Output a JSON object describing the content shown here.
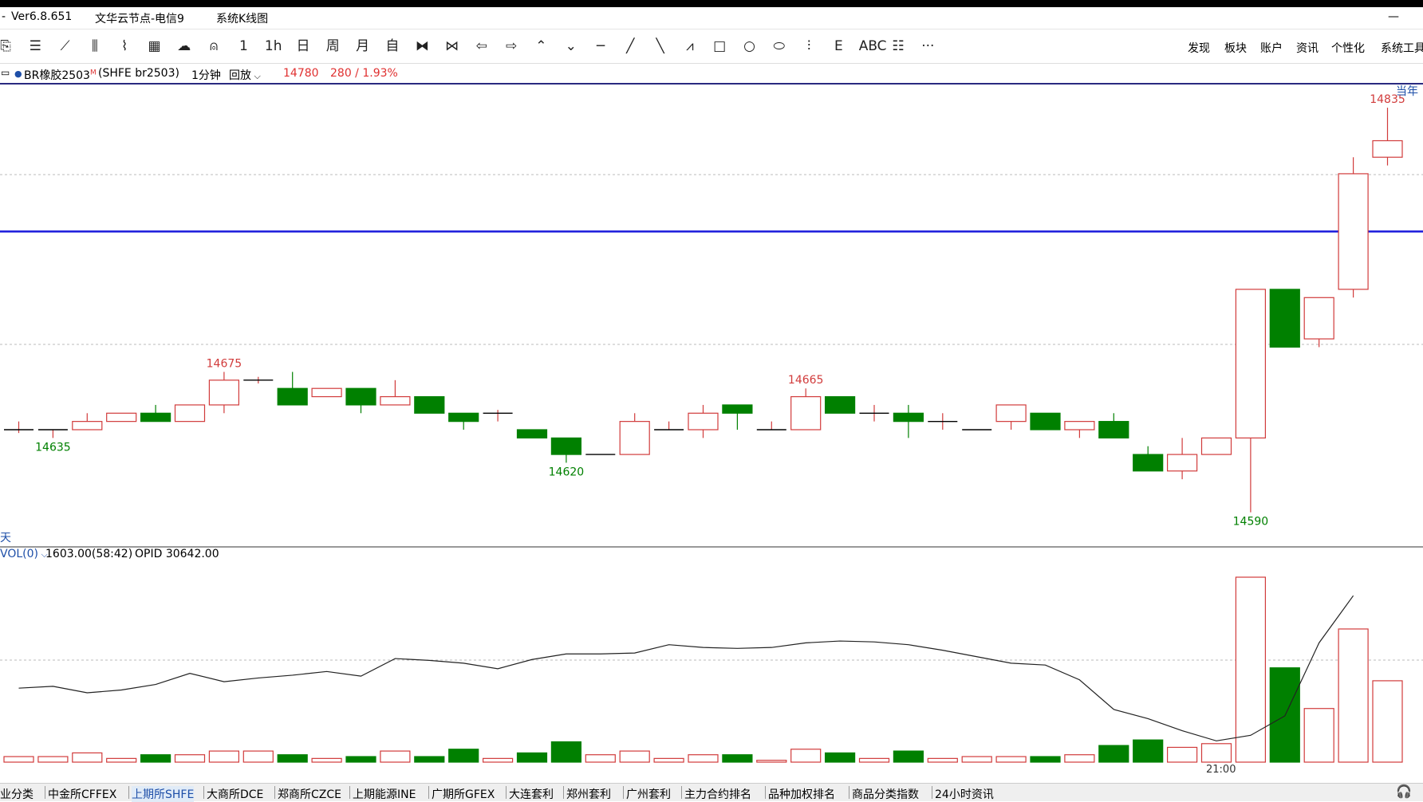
{
  "window": {
    "version": "Ver6.8.651",
    "node": "文华云节点-电信9",
    "view": "系统K线图",
    "minimize": "—",
    "dash": "-"
  },
  "toolbar": {
    "icons": [
      "save-icon",
      "list-icon",
      "line-chart-icon",
      "candlestick-icon",
      "draw-icon",
      "grid-icon",
      "cloud-icon",
      "bell-icon",
      "1min-period",
      "1h-period",
      "day-period",
      "week-period",
      "month-period",
      "custom-period",
      "zoom-in-icon",
      "zoom-out-icon",
      "arrow-left-icon",
      "arrow-right-icon",
      "arrow-up-icon",
      "arrow-down-icon",
      "horizontal-line-tool",
      "trend-line-tool",
      "ray-tool",
      "polyline-tool",
      "rectangle-tool",
      "circle-tool",
      "ellipse-tool",
      "fibonacci-tool",
      "text-E-tool",
      "abc-text-tool",
      "wave-tool",
      "more-icon"
    ],
    "glyphs": [
      "⎘",
      "☰",
      "⟋",
      "⫼",
      "⌇",
      "▦",
      "☁",
      "⍝",
      "1",
      "1h",
      "日",
      "周",
      "月",
      "自",
      "⧓",
      "⋈",
      "⇦",
      "⇨",
      "⌃",
      "⌄",
      "─",
      "╱",
      "╲",
      "⩘",
      "□",
      "○",
      "⬭",
      "⫶",
      "E",
      "ABC",
      "☷",
      "···"
    ],
    "menu": [
      "发现",
      "板块",
      "账户",
      "资讯",
      "个性化",
      "系统工具"
    ]
  },
  "instrument": {
    "name": "BR橡胶2503",
    "sup": "M",
    "code": "(SHFE br2503)",
    "period": "1分钟",
    "mode": "回放",
    "last": "14780",
    "change": "280 / 1.93%"
  },
  "price_panel": {
    "top_right": "当年",
    "bottom_left": "天"
  },
  "volume_panel": {
    "indicator": "VOL(0)",
    "vol_text": "1603.00(58:42)",
    "opid_text": "OPID 30642.00",
    "time_label": "21:00"
  },
  "chart_data": {
    "type": "candlestick",
    "price_ylim": [
      14570,
      14850
    ],
    "annotations": [
      {
        "text": "14635",
        "index": 1,
        "kind": "low"
      },
      {
        "text": "14675",
        "index": 6,
        "kind": "high"
      },
      {
        "text": "14620",
        "index": 16,
        "kind": "low"
      },
      {
        "text": "14665",
        "index": 23,
        "kind": "high"
      },
      {
        "text": "14590",
        "index": 36,
        "kind": "low"
      },
      {
        "text": "14835",
        "index": 40,
        "kind": "high"
      }
    ],
    "reference_line": 14760,
    "candles": [
      {
        "o": 14640,
        "h": 14645,
        "l": 14638,
        "c": 14640,
        "v": 3
      },
      {
        "o": 14640,
        "h": 14640,
        "l": 14635,
        "c": 14640,
        "v": 3
      },
      {
        "o": 14640,
        "h": 14650,
        "l": 14640,
        "c": 14645,
        "v": 5
      },
      {
        "o": 14645,
        "h": 14650,
        "l": 14645,
        "c": 14650,
        "v": 2
      },
      {
        "o": 14650,
        "h": 14655,
        "l": 14645,
        "c": 14645,
        "v": 4
      },
      {
        "o": 14645,
        "h": 14655,
        "l": 14645,
        "c": 14655,
        "v": 4
      },
      {
        "o": 14655,
        "h": 14675,
        "l": 14650,
        "c": 14670,
        "v": 6
      },
      {
        "o": 14670,
        "h": 14672,
        "l": 14668,
        "c": 14670,
        "v": 6
      },
      {
        "o": 14665,
        "h": 14675,
        "l": 14655,
        "c": 14655,
        "v": 4
      },
      {
        "o": 14660,
        "h": 14665,
        "l": 14660,
        "c": 14665,
        "v": 2
      },
      {
        "o": 14665,
        "h": 14665,
        "l": 14650,
        "c": 14655,
        "v": 3
      },
      {
        "o": 14655,
        "h": 14670,
        "l": 14655,
        "c": 14660,
        "v": 6
      },
      {
        "o": 14660,
        "h": 14660,
        "l": 14650,
        "c": 14650,
        "v": 3
      },
      {
        "o": 14650,
        "h": 14650,
        "l": 14640,
        "c": 14645,
        "v": 7
      },
      {
        "o": 14650,
        "h": 14652,
        "l": 14645,
        "c": 14650,
        "v": 2
      },
      {
        "o": 14640,
        "h": 14640,
        "l": 14635,
        "c": 14635,
        "v": 5
      },
      {
        "o": 14635,
        "h": 14635,
        "l": 14620,
        "c": 14625,
        "v": 11
      },
      {
        "o": 14625,
        "h": 14625,
        "l": 14625,
        "c": 14625,
        "v": 4
      },
      {
        "o": 14625,
        "h": 14650,
        "l": 14625,
        "c": 14645,
        "v": 6
      },
      {
        "o": 14640,
        "h": 14645,
        "l": 14640,
        "c": 14640,
        "v": 2
      },
      {
        "o": 14640,
        "h": 14655,
        "l": 14635,
        "c": 14650,
        "v": 4
      },
      {
        "o": 14655,
        "h": 14655,
        "l": 14640,
        "c": 14650,
        "v": 4
      },
      {
        "o": 14640,
        "h": 14645,
        "l": 14640,
        "c": 14640,
        "v": 1
      },
      {
        "o": 14640,
        "h": 14665,
        "l": 14640,
        "c": 14660,
        "v": 7
      },
      {
        "o": 14660,
        "h": 14660,
        "l": 14650,
        "c": 14650,
        "v": 5
      },
      {
        "o": 14650,
        "h": 14655,
        "l": 14645,
        "c": 14650,
        "v": 2
      },
      {
        "o": 14650,
        "h": 14655,
        "l": 14635,
        "c": 14645,
        "v": 6
      },
      {
        "o": 14645,
        "h": 14650,
        "l": 14640,
        "c": 14645,
        "v": 2
      },
      {
        "o": 14640,
        "h": 14640,
        "l": 14640,
        "c": 14640,
        "v": 3
      },
      {
        "o": 14645,
        "h": 14655,
        "l": 14640,
        "c": 14655,
        "v": 3
      },
      {
        "o": 14650,
        "h": 14650,
        "l": 14640,
        "c": 14640,
        "v": 3
      },
      {
        "o": 14640,
        "h": 14645,
        "l": 14635,
        "c": 14645,
        "v": 4
      },
      {
        "o": 14645,
        "h": 14650,
        "l": 14640,
        "c": 14635,
        "v": 9
      },
      {
        "o": 14625,
        "h": 14630,
        "l": 14615,
        "c": 14615,
        "v": 12
      },
      {
        "o": 14615,
        "h": 14635,
        "l": 14610,
        "c": 14625,
        "v": 8
      },
      {
        "o": 14625,
        "h": 14635,
        "l": 14625,
        "c": 14635,
        "v": 10
      },
      {
        "o": 14635,
        "h": 14725,
        "l": 14590,
        "c": 14725,
        "v": 100
      },
      {
        "o": 14725,
        "h": 14725,
        "l": 14690,
        "c": 14690,
        "v": 51
      },
      {
        "o": 14695,
        "h": 14720,
        "l": 14690,
        "c": 14720,
        "v": 29
      },
      {
        "o": 14725,
        "h": 14805,
        "l": 14720,
        "c": 14795,
        "v": 72
      },
      {
        "o": 14805,
        "h": 14835,
        "l": 14800,
        "c": 14815,
        "v": 44
      }
    ],
    "opid_line": [
      620,
      622,
      615,
      618,
      624,
      636,
      627,
      631,
      634,
      638,
      633,
      652,
      650,
      647,
      641,
      651,
      657,
      657,
      658,
      667,
      664,
      663,
      664,
      669,
      671,
      670,
      667,
      661,
      654,
      647,
      645,
      629,
      597,
      587,
      574,
      563,
      569,
      590,
      669,
      720
    ]
  },
  "tabs": [
    "业分类",
    "中金所CFFEX",
    "上期所SHFE",
    "大商所DCE",
    "郑商所CZCE",
    "上期能源INE",
    "广期所GFEX",
    "大连套利",
    "郑州套利",
    "广州套利",
    "主力合约排名",
    "品种加权排名",
    "商品分类指数",
    "24小时资讯"
  ],
  "active_tab": 2,
  "colors": {
    "up": "#d13b3b",
    "down": "#008000",
    "reference": "#1a1adc",
    "info_red": "#e03030"
  }
}
